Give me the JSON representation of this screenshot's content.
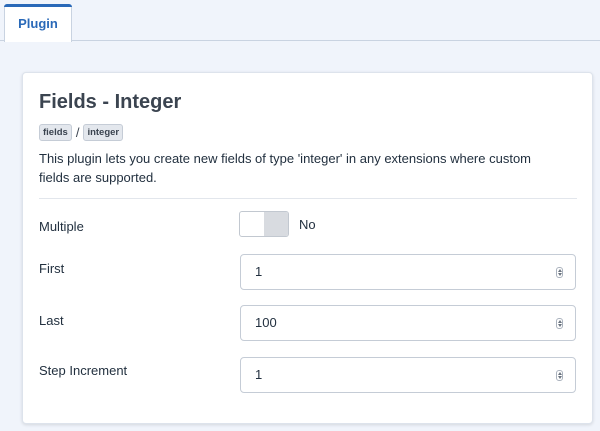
{
  "tabs": [
    {
      "label": "Plugin",
      "active": true
    }
  ],
  "plugin": {
    "title": "Fields - Integer",
    "tags": [
      "fields",
      "integer"
    ],
    "tag_separator": "/",
    "description": "This plugin lets you create new fields of type 'integer' in any extensions where custom fields are supported."
  },
  "fields": {
    "multiple": {
      "label": "Multiple",
      "value": "No"
    },
    "first": {
      "label": "First",
      "value": "1"
    },
    "last": {
      "label": "Last",
      "value": "100"
    },
    "step": {
      "label": "Step Increment",
      "value": "1"
    }
  },
  "colors": {
    "accent": "#2a69b8",
    "background": "#f0f4fb",
    "card": "#ffffff"
  }
}
